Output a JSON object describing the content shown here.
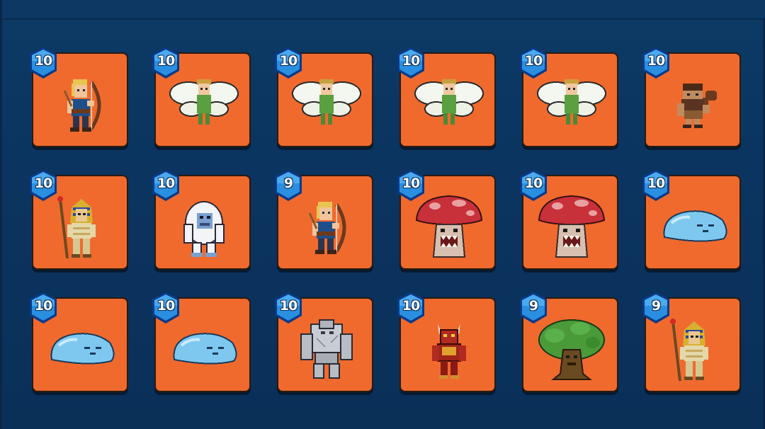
{
  "header": {
    "title": ""
  },
  "cards": [
    {
      "level": "10",
      "unit": "elf-archer-icon"
    },
    {
      "level": "10",
      "unit": "fairy-icon"
    },
    {
      "level": "10",
      "unit": "fairy-icon"
    },
    {
      "level": "10",
      "unit": "fairy-icon"
    },
    {
      "level": "10",
      "unit": "fairy-icon"
    },
    {
      "level": "10",
      "unit": "caveman-icon"
    },
    {
      "level": "10",
      "unit": "pharaoh-icon"
    },
    {
      "level": "10",
      "unit": "yeti-icon"
    },
    {
      "level": "9",
      "unit": "elf-archer-icon"
    },
    {
      "level": "10",
      "unit": "mushroom-monster-icon"
    },
    {
      "level": "10",
      "unit": "mushroom-monster-icon"
    },
    {
      "level": "10",
      "unit": "blue-slime-icon"
    },
    {
      "level": "10",
      "unit": "blue-slime-icon"
    },
    {
      "level": "10",
      "unit": "blue-slime-icon"
    },
    {
      "level": "10",
      "unit": "stone-golem-icon"
    },
    {
      "level": "10",
      "unit": "red-demon-icon"
    },
    {
      "level": "9",
      "unit": "treant-icon"
    },
    {
      "level": "9",
      "unit": "pharaoh-icon"
    }
  ],
  "colors": {
    "background": "#0b3460",
    "card": "#f06a2e",
    "badge": "#2a8fe0"
  }
}
